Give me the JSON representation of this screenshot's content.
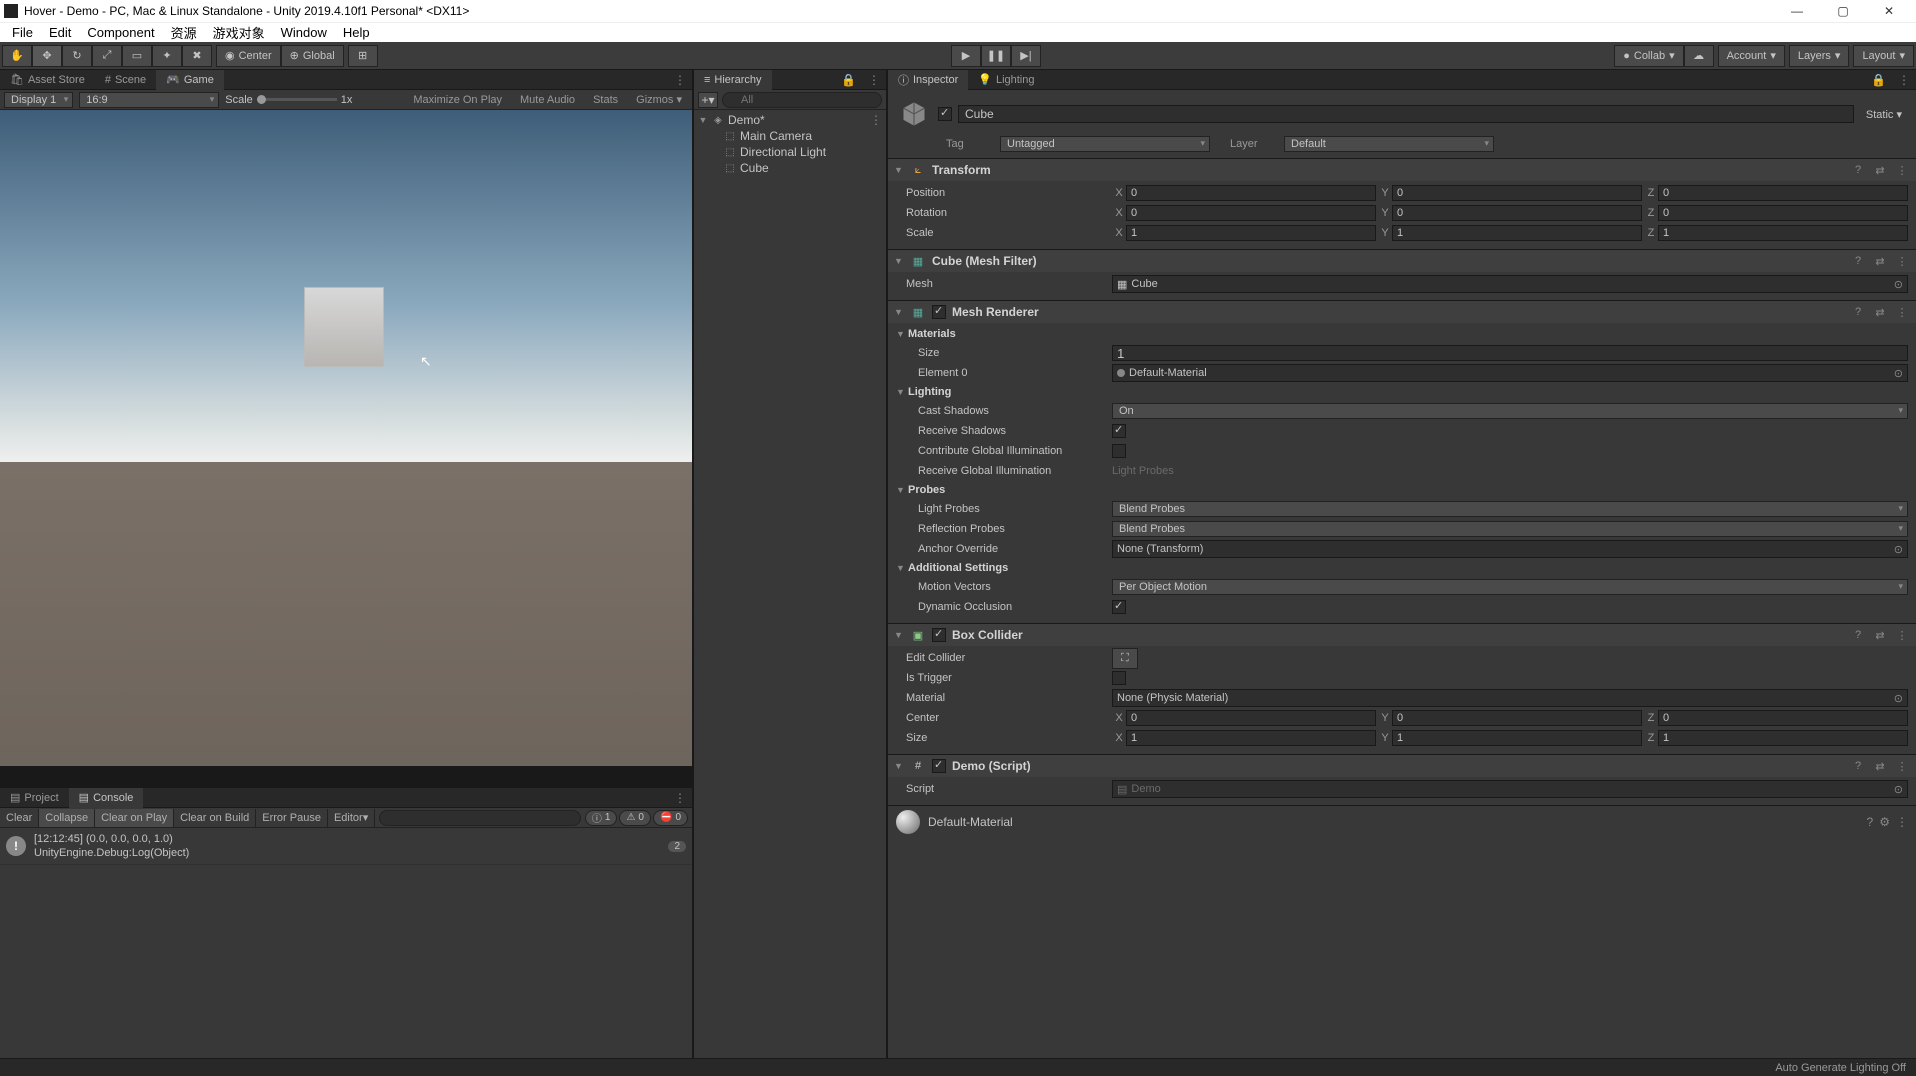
{
  "window": {
    "title": "Hover - Demo - PC, Mac & Linux Standalone - Unity 2019.4.10f1 Personal* <DX11>"
  },
  "menus": [
    "File",
    "Edit",
    "Component",
    "资源",
    "游戏对象",
    "Window",
    "Help"
  ],
  "toolbar": {
    "pivot": "Center",
    "space": "Global",
    "collab": "Collab",
    "account": "Account",
    "layers": "Layers",
    "layout": "Layout"
  },
  "left_tabs": {
    "asset": "Asset Store",
    "scene": "Scene",
    "game": "Game"
  },
  "game": {
    "display": "Display 1",
    "aspect": "16:9",
    "scale_label": "Scale",
    "scale_value": "1x",
    "max": "Maximize On Play",
    "mute": "Mute Audio",
    "stats": "Stats",
    "gizmos": "Gizmos"
  },
  "hierarchy": {
    "title": "Hierarchy",
    "search_placeholder": "All",
    "scene": "Demo*",
    "items": [
      "Main Camera",
      "Directional Light",
      "Cube"
    ]
  },
  "inspector": {
    "tab_inspector": "Inspector",
    "tab_lighting": "Lighting",
    "name": "Cube",
    "static": "Static",
    "tag_label": "Tag",
    "tag": "Untagged",
    "layer_label": "Layer",
    "layer": "Default",
    "transform": {
      "title": "Transform",
      "position": "Position",
      "pos": [
        "0",
        "0",
        "0"
      ],
      "rotation": "Rotation",
      "rot": [
        "0",
        "0",
        "0"
      ],
      "scale": "Scale",
      "scl": [
        "1",
        "1",
        "1"
      ]
    },
    "meshfilter": {
      "title": "Cube (Mesh Filter)",
      "mesh_label": "Mesh",
      "mesh": "Cube"
    },
    "renderer": {
      "title": "Mesh Renderer",
      "materials": "Materials",
      "size_label": "Size",
      "size": "1",
      "element0_label": "Element 0",
      "element0": "Default-Material",
      "lighting": "Lighting",
      "cast_label": "Cast Shadows",
      "cast": "On",
      "receive": "Receive Shadows",
      "contrib": "Contribute Global Illumination",
      "receive_gi": "Receive Global Illumination",
      "receive_gi_val": "Light Probes",
      "probes": "Probes",
      "light_probes_label": "Light Probes",
      "light_probes": "Blend Probes",
      "refl_label": "Reflection Probes",
      "refl": "Blend Probes",
      "anchor_label": "Anchor Override",
      "anchor": "None (Transform)",
      "addl": "Additional Settings",
      "motion_label": "Motion Vectors",
      "motion": "Per Object Motion",
      "dyn": "Dynamic Occlusion"
    },
    "collider": {
      "title": "Box Collider",
      "edit": "Edit Collider",
      "trigger": "Is Trigger",
      "mat_label": "Material",
      "mat": "None (Physic Material)",
      "center": "Center",
      "cen": [
        "0",
        "0",
        "0"
      ],
      "size": "Size",
      "sz": [
        "1",
        "1",
        "1"
      ]
    },
    "script": {
      "title": "Demo (Script)",
      "label": "Script",
      "name": "Demo"
    },
    "material": "Default-Material"
  },
  "project_tabs": {
    "project": "Project",
    "console": "Console"
  },
  "console": {
    "clear": "Clear",
    "collapse": "Collapse",
    "cop": "Clear on Play",
    "cob": "Clear on Build",
    "ep": "Error Pause",
    "editor": "Editor",
    "info_count": "1",
    "warn_count": "0",
    "err_count": "0",
    "log_time": "[12:12:45] (0.0, 0.0, 0.0, 1.0)",
    "log_src": "UnityEngine.Debug:Log(Object)",
    "log_count": "2"
  },
  "status": "Auto Generate Lighting Off"
}
